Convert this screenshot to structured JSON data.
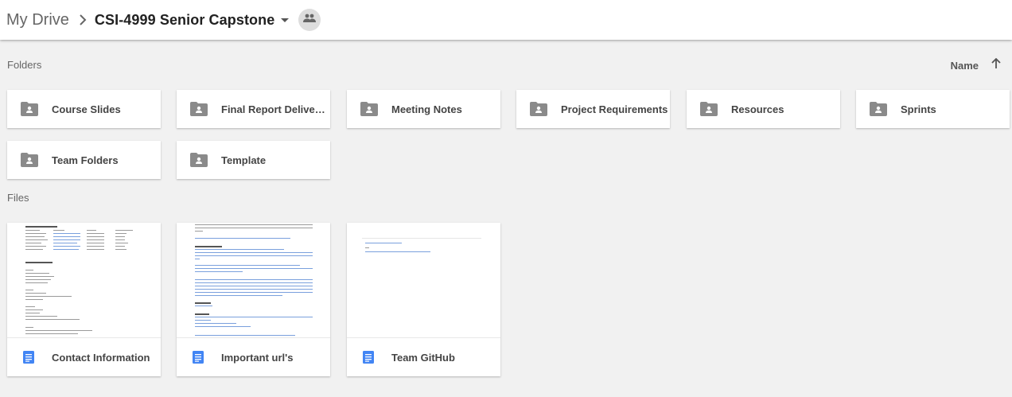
{
  "header": {
    "root_label": "My Drive",
    "separator_icon": "chevron-right-icon",
    "current_folder": "CSI-4999 Senior Capstone",
    "dropdown_icon": "caret-down-icon",
    "shared_icon": "people-icon"
  },
  "folders_section": {
    "label": "Folders",
    "sort_label": "Name",
    "sort_icon": "arrow-up-icon",
    "items": [
      {
        "name": "Course Slides"
      },
      {
        "name": "Final Report Deliverables"
      },
      {
        "name": "Meeting Notes"
      },
      {
        "name": "Project Requirements"
      },
      {
        "name": "Resources"
      },
      {
        "name": "Sprints"
      },
      {
        "name": "Team Folders"
      },
      {
        "name": "Template"
      }
    ]
  },
  "files_section": {
    "label": "Files",
    "items": [
      {
        "name": "Contact Information",
        "type": "google-doc"
      },
      {
        "name": "Important url's",
        "type": "google-doc"
      },
      {
        "name": "Team GitHub",
        "type": "google-doc"
      }
    ]
  },
  "colors": {
    "header_bg": "#ffffff",
    "page_bg": "#f1f1f1",
    "doc_icon_blue": "#4285f4",
    "folder_icon_gray": "#8a8a8a"
  }
}
